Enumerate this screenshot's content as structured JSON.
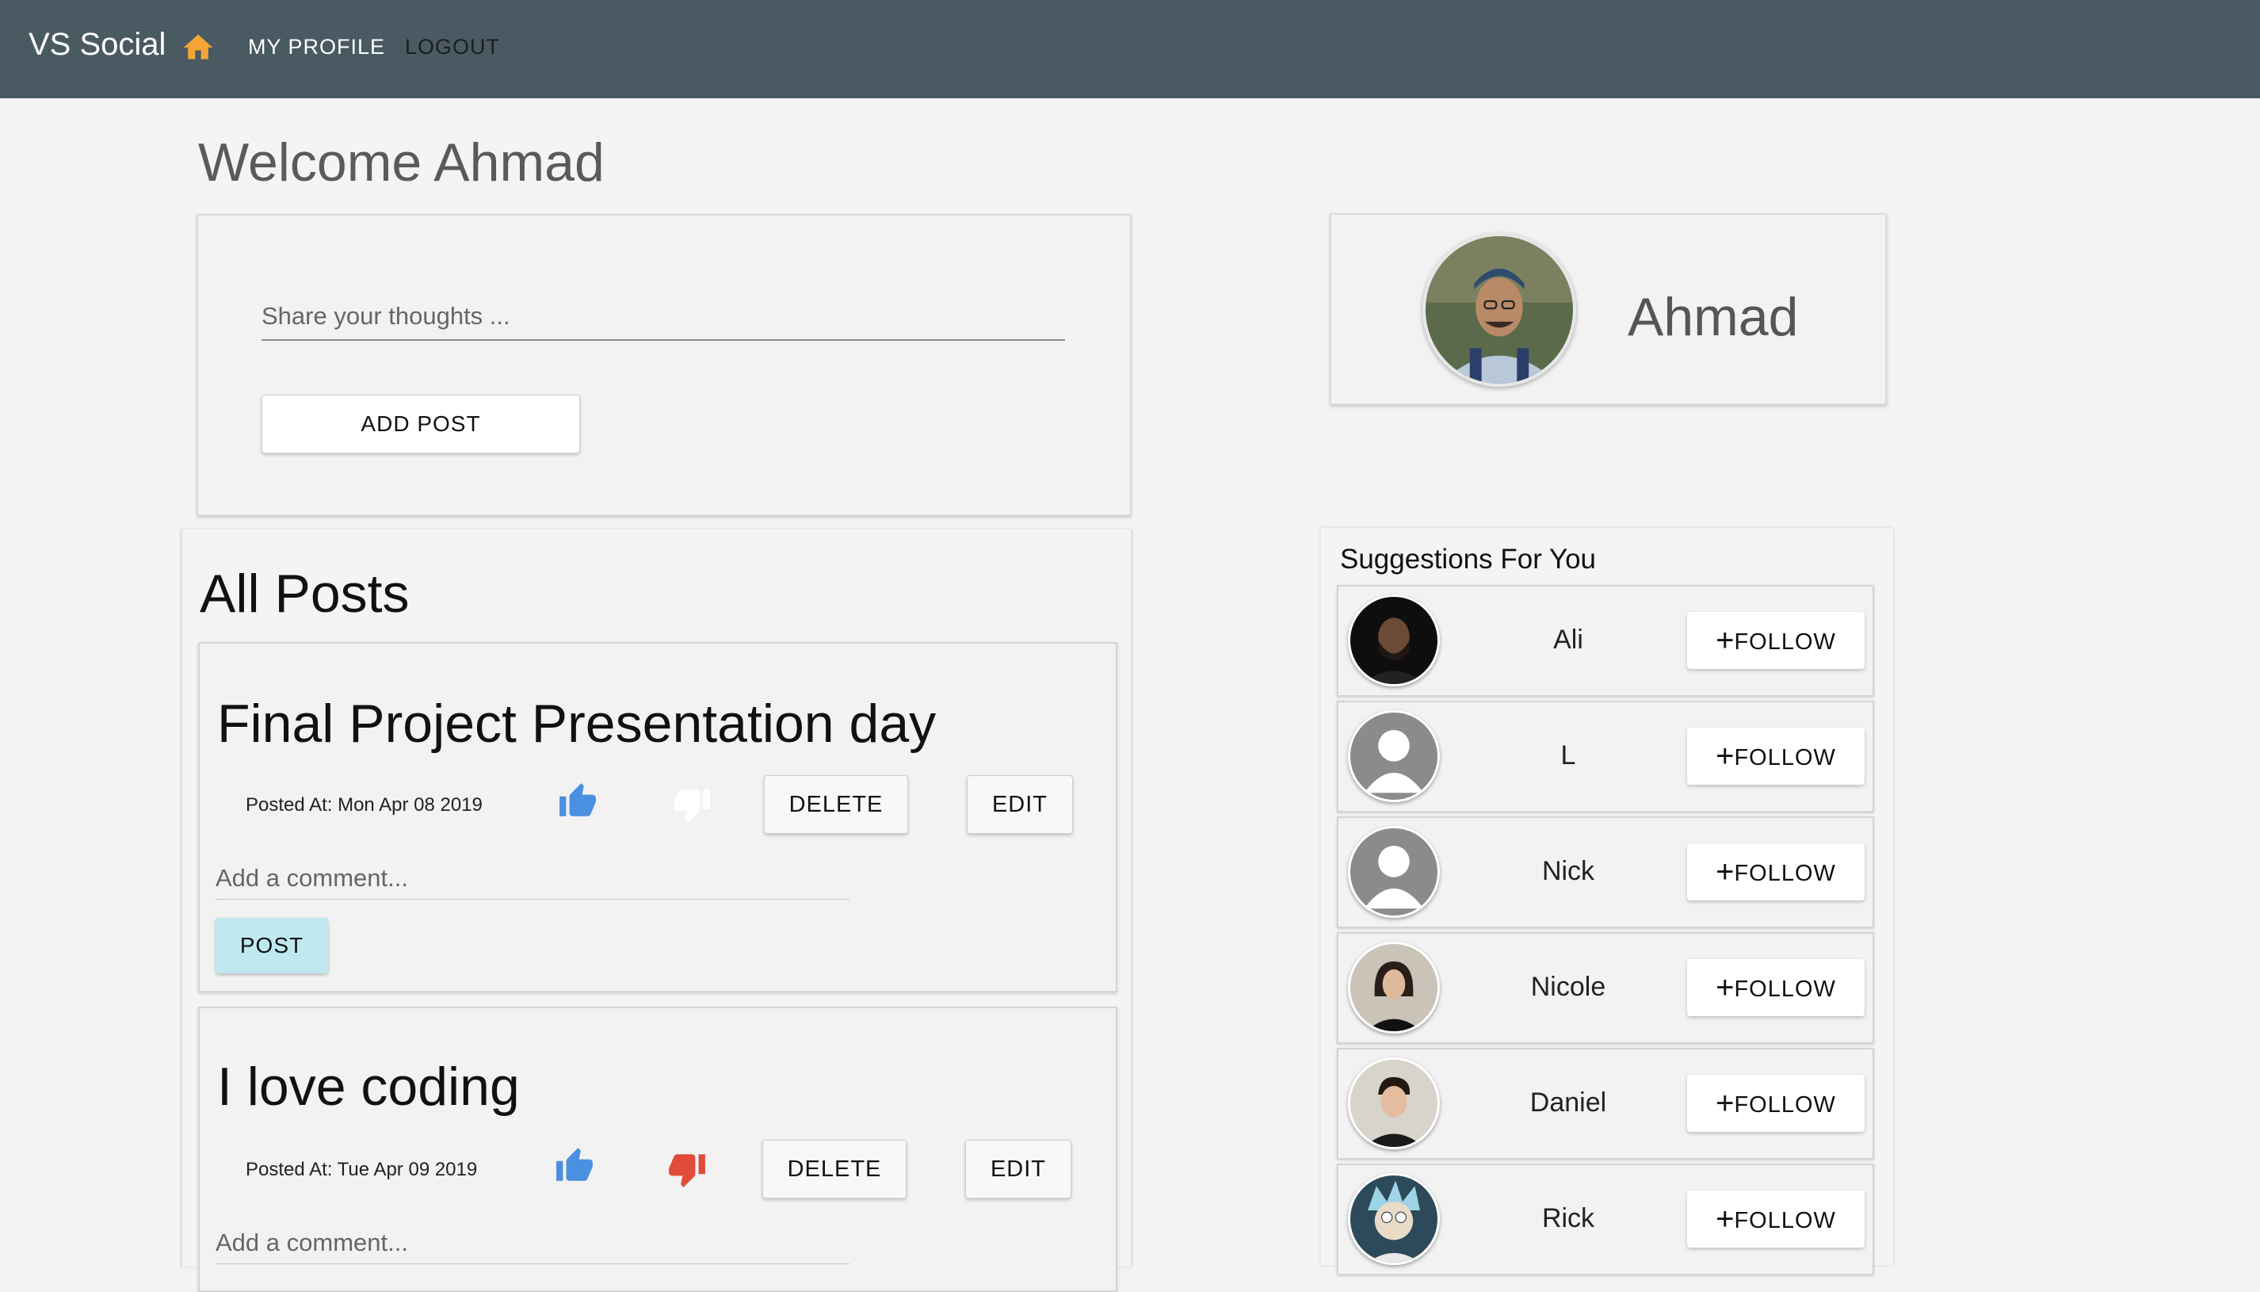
{
  "nav": {
    "brand": "VS Social",
    "my_profile": "MY PROFILE",
    "logout": "LOGOUT",
    "home_icon": "home-icon",
    "home_color": "#f3a536"
  },
  "welcome": "Welcome Ahmad",
  "compose": {
    "placeholder": "Share your thoughts ...",
    "add_post": "ADD POST"
  },
  "profile": {
    "name": "Ahmad"
  },
  "posts": {
    "title": "All Posts",
    "items": [
      {
        "title": "Final Project Presentation day",
        "posted": "Posted At: Mon Apr 08 2019",
        "delete": "DELETE",
        "edit": "EDIT",
        "comment_placeholder": "Add a comment...",
        "post": "POST",
        "like_color": "#4a8fe0",
        "dislike_color": "#ffffff"
      },
      {
        "title": "I love coding",
        "posted": "Posted At: Tue Apr 09 2019",
        "delete": "DELETE",
        "edit": "EDIT",
        "comment_placeholder": "Add a comment...",
        "like_color": "#4a8fe0",
        "dislike_color": "#e04b3a"
      }
    ]
  },
  "suggestions": {
    "title": "Suggestions For You",
    "follow_label": "FOLLOW",
    "follow_plus": "+",
    "items": [
      {
        "name": "Ali"
      },
      {
        "name": "L"
      },
      {
        "name": "Nick"
      },
      {
        "name": "Nicole"
      },
      {
        "name": "Daniel"
      },
      {
        "name": "Rick"
      }
    ]
  }
}
